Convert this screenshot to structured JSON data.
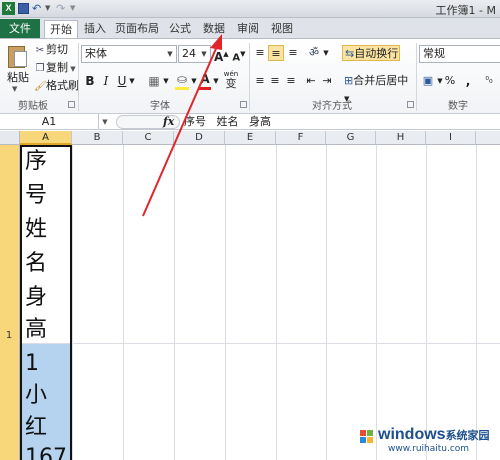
{
  "window": {
    "title": "工作簿1 - M",
    "app_icon": "X"
  },
  "quick_access": {
    "icons": [
      "save-icon",
      "undo-icon",
      "redo-icon"
    ]
  },
  "tabs": [
    "文件",
    "开始",
    "插入",
    "页面布局",
    "公式",
    "数据",
    "审阅",
    "视图"
  ],
  "active_tab": "开始",
  "ribbon": {
    "clipboard": {
      "paste": "粘贴",
      "cut": "剪切",
      "copy": "复制",
      "format_painter": "格式刷",
      "label": "剪贴板"
    },
    "font": {
      "name": "宋体",
      "size": "24",
      "grow": "A",
      "shrink": "A",
      "bold": "B",
      "italic": "I",
      "underline": "U",
      "font_color": "A",
      "phonetic": "wén",
      "phonetic_char": "变",
      "label": "字体"
    },
    "alignment": {
      "wrap_text": "自动换行",
      "merge_center": "合并后居中",
      "label": "对齐方式"
    },
    "number": {
      "format": "常规",
      "percent": "%",
      "comma": ",",
      "label": "数字"
    }
  },
  "formula_bar": {
    "name_box": "A1",
    "fx": "fx",
    "content": "序号   姓名   身高"
  },
  "sheet": {
    "columns": [
      "A",
      "B",
      "C",
      "D",
      "E",
      "F",
      "G",
      "H",
      "I"
    ],
    "selected_column": "A",
    "row_number": "1",
    "cell_a1_lines": [
      "序",
      "号",
      "姓",
      "名",
      "身",
      "高",
      "1",
      "小",
      "红",
      "167"
    ]
  },
  "colors": {
    "file_tab": "#1e7145",
    "selection_header": "#f8d77b",
    "selection_fill": "#b5d3ef",
    "annotation_arrow": "#e0262b"
  },
  "watermark": {
    "brand": "windows",
    "brand_cn": "系统家园",
    "url": "www.ruihaitu.com"
  }
}
